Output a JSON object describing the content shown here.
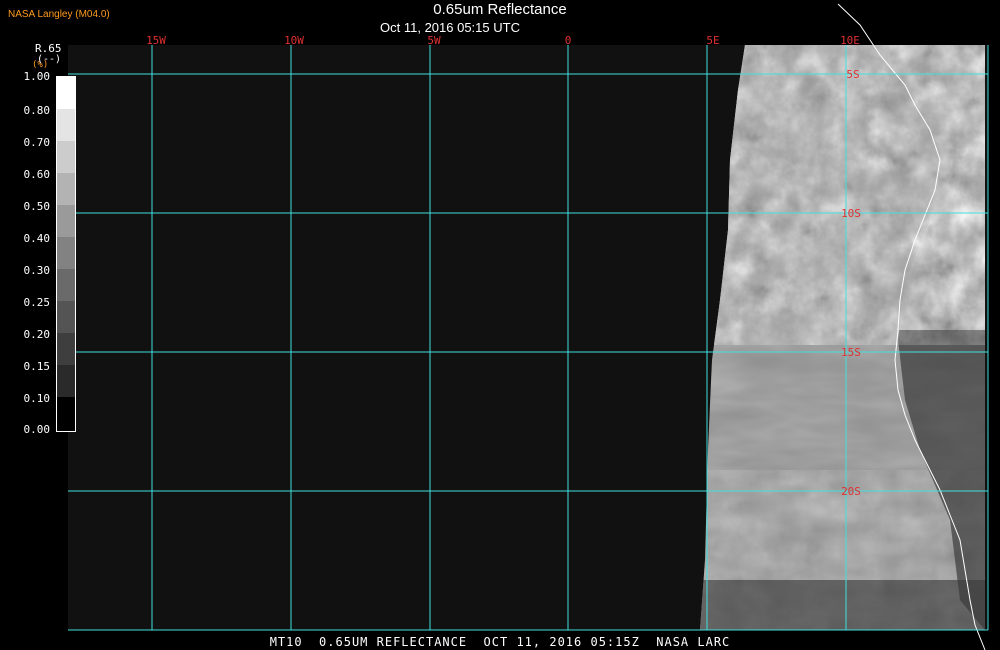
{
  "header": {
    "organization": "NASA Langley (M04.0)",
    "title": "0.65um Reflectance",
    "subtitle": "Oct 11, 2016 05:15 UTC"
  },
  "legend": {
    "variable": "R.65",
    "units": "(%)",
    "scale_label": "(--)",
    "ticks": [
      "1.00",
      "0.80",
      "0.70",
      "0.60",
      "0.50",
      "0.40",
      "0.30",
      "0.25",
      "0.20",
      "0.15",
      "0.10",
      "0.00"
    ]
  },
  "grid": {
    "lon_labels": [
      "15W",
      "10W",
      "5W",
      "0",
      "5E",
      "10E"
    ],
    "lat_labels": [
      "5S",
      "10S",
      "15S",
      "20S"
    ],
    "line_color": "#40e0e0",
    "label_color": "#e03030"
  },
  "footer": {
    "text": "MT10  0.65UM REFLECTANCE  OCT 11, 2016 05:15Z  NASA LARC"
  },
  "colors": {
    "background": "#000000",
    "no_data": "#111111",
    "coastline": "#ffffff"
  }
}
